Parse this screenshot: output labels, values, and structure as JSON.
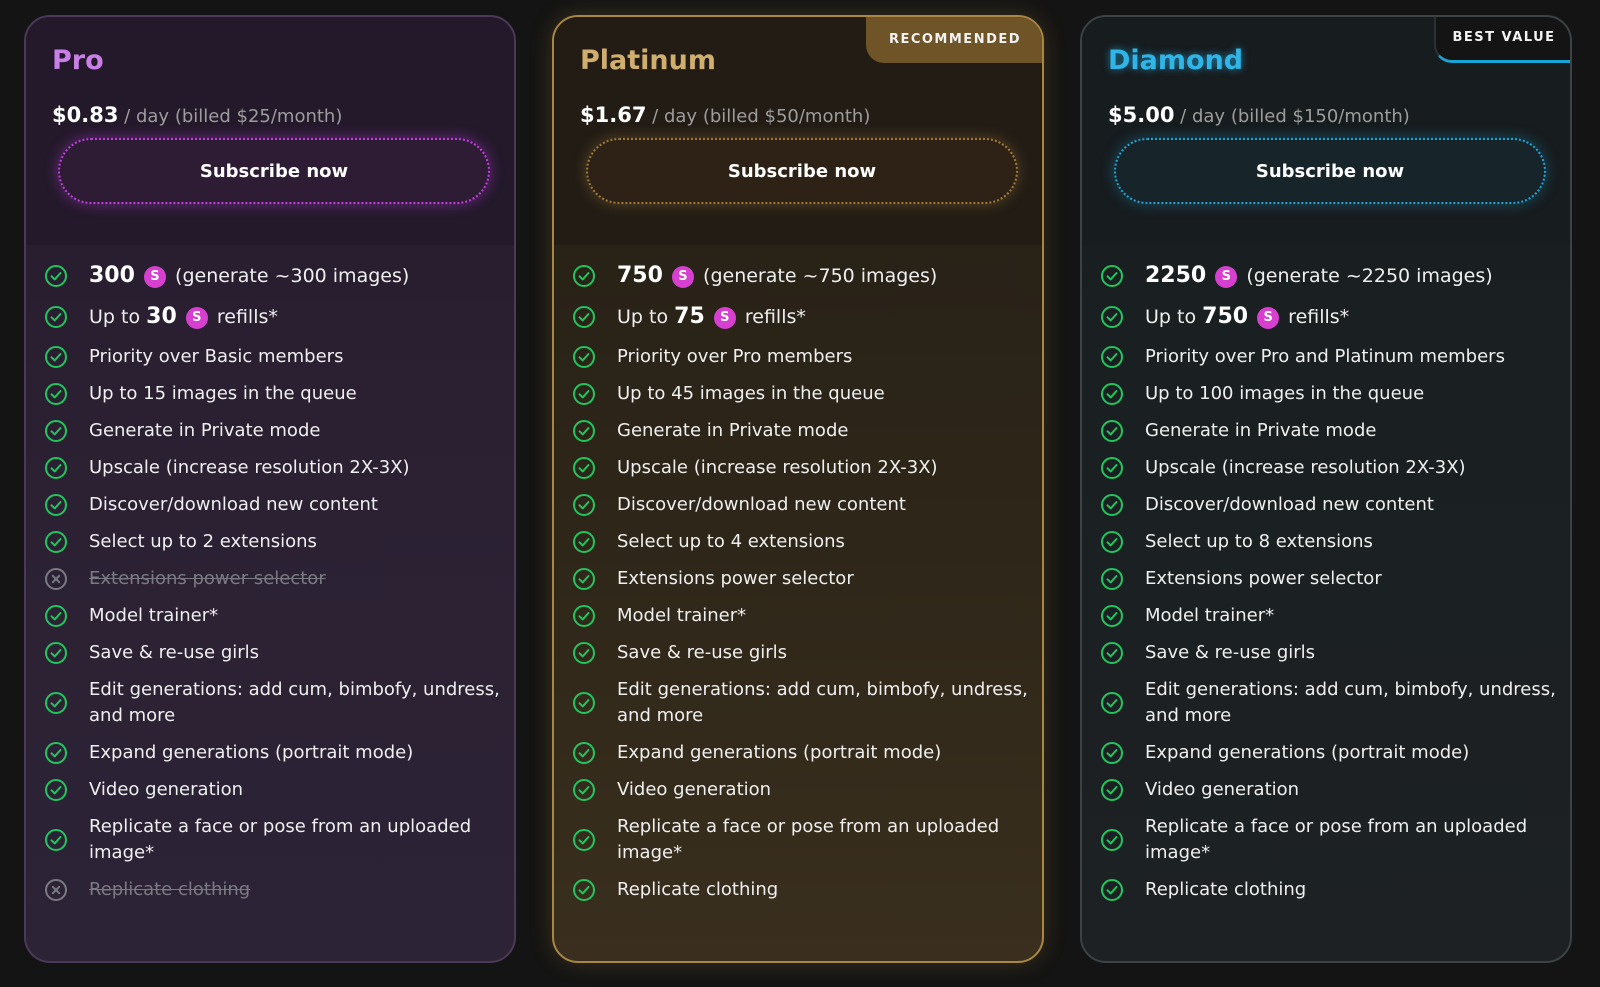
{
  "subscribe_label": "Subscribe now",
  "plans": [
    {
      "name": "Pro",
      "price": "$0.83",
      "per": "/ day",
      "billed": "(billed $25/month)",
      "tag": "",
      "theme_color": "#c97fe8",
      "features": [
        {
          "type": "credits",
          "pre": "",
          "num": "300",
          "post": "(generate ~300 images)",
          "on": true
        },
        {
          "type": "credits",
          "pre": "Up to",
          "num": "30",
          "post": "refills*",
          "on": true
        },
        {
          "text": "Priority over Basic members",
          "on": true
        },
        {
          "text": "Up to 15 images in the queue",
          "on": true
        },
        {
          "text": "Generate in Private mode",
          "on": true
        },
        {
          "text": "Upscale (increase resolution 2X-3X)",
          "on": true
        },
        {
          "text": "Discover/download new content",
          "on": true
        },
        {
          "text": "Select up to 2 extensions",
          "on": true
        },
        {
          "text": "Extensions power selector",
          "on": false
        },
        {
          "text": "Model trainer*",
          "on": true
        },
        {
          "text": "Save & re-use girls",
          "on": true
        },
        {
          "text": "Edit generations: add cum, bimbofy, undress, and more",
          "on": true
        },
        {
          "text": "Expand generations (portrait mode)",
          "on": true
        },
        {
          "text": "Video generation",
          "on": true
        },
        {
          "text": "Replicate a face or pose from an uploaded image*",
          "on": true
        },
        {
          "text": "Replicate clothing",
          "on": false
        }
      ]
    },
    {
      "name": "Platinum",
      "price": "$1.67",
      "per": "/ day",
      "billed": "(billed $50/month)",
      "tag": "RECOMMENDED",
      "theme_color": "#d0ae6e",
      "features": [
        {
          "type": "credits",
          "pre": "",
          "num": "750",
          "post": "(generate ~750 images)",
          "on": true
        },
        {
          "type": "credits",
          "pre": "Up to",
          "num": "75",
          "post": "refills*",
          "on": true
        },
        {
          "text": "Priority over Pro members",
          "on": true
        },
        {
          "text": "Up to 45 images in the queue",
          "on": true
        },
        {
          "text": "Generate in Private mode",
          "on": true
        },
        {
          "text": "Upscale (increase resolution 2X-3X)",
          "on": true
        },
        {
          "text": "Discover/download new content",
          "on": true
        },
        {
          "text": "Select up to 4 extensions",
          "on": true
        },
        {
          "text": "Extensions power selector",
          "on": true
        },
        {
          "text": "Model trainer*",
          "on": true
        },
        {
          "text": "Save & re-use girls",
          "on": true
        },
        {
          "text": "Edit generations: add cum, bimbofy, undress, and more",
          "on": true
        },
        {
          "text": "Expand generations (portrait mode)",
          "on": true
        },
        {
          "text": "Video generation",
          "on": true
        },
        {
          "text": "Replicate a face or pose from an uploaded image*",
          "on": true
        },
        {
          "text": "Replicate clothing",
          "on": true
        }
      ]
    },
    {
      "name": "Diamond",
      "price": "$5.00",
      "per": "/ day",
      "billed": "(billed $150/month)",
      "tag": "BEST VALUE",
      "theme_color": "#2fb6e6",
      "features": [
        {
          "type": "credits",
          "pre": "",
          "num": "2250",
          "post": "(generate ~2250 images)",
          "on": true
        },
        {
          "type": "credits",
          "pre": "Up to",
          "num": "750",
          "post": "refills*",
          "on": true
        },
        {
          "text": "Priority over Pro and Platinum members",
          "on": true
        },
        {
          "text": "Up to 100 images in the queue",
          "on": true
        },
        {
          "text": "Generate in Private mode",
          "on": true
        },
        {
          "text": "Upscale (increase resolution 2X-3X)",
          "on": true
        },
        {
          "text": "Discover/download new content",
          "on": true
        },
        {
          "text": "Select up to 8 extensions",
          "on": true
        },
        {
          "text": "Extensions power selector",
          "on": true
        },
        {
          "text": "Model trainer*",
          "on": true
        },
        {
          "text": "Save & re-use girls",
          "on": true
        },
        {
          "text": "Edit generations: add cum, bimbofy, undress, and more",
          "on": true
        },
        {
          "text": "Expand generations (portrait mode)",
          "on": true
        },
        {
          "text": "Video generation",
          "on": true
        },
        {
          "text": "Replicate a face or pose from an uploaded image*",
          "on": true
        },
        {
          "text": "Replicate clothing",
          "on": true
        }
      ]
    }
  ],
  "coin_symbol": "S",
  "colors": {
    "check": "#22c55e",
    "cross": "#7a7a82",
    "coin": "#d63fcf"
  },
  "icons": {
    "included": "check-circle-icon",
    "excluded": "x-circle-icon",
    "credit": "credit-coin-icon"
  }
}
